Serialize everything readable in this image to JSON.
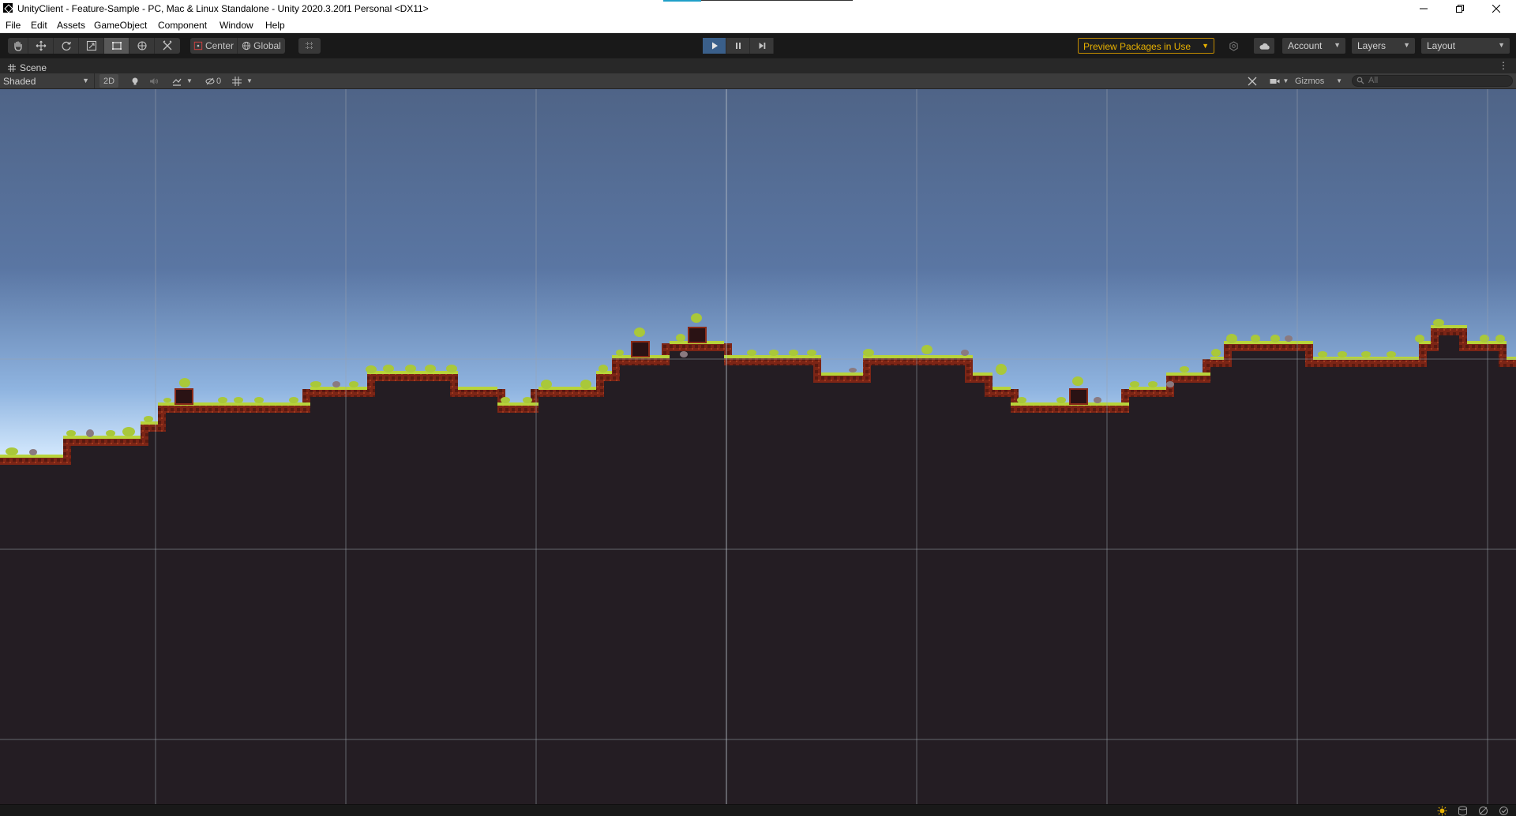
{
  "window": {
    "title": "UnityClient - Feature-Sample - PC, Mac & Linux Standalone - Unity 2020.3.20f1 Personal <DX11>",
    "controls": [
      "minimize",
      "maximize",
      "close"
    ]
  },
  "menu": {
    "items": [
      "File",
      "Edit",
      "Assets",
      "GameObject",
      "Component",
      "Window",
      "Help"
    ]
  },
  "toolbar": {
    "tools": [
      "hand-tool",
      "move-tool",
      "rotate-tool",
      "scale-tool",
      "rect-tool",
      "transform-tool",
      "custom-tool"
    ],
    "active_tool": "rect-tool",
    "pivot_mode": "Center",
    "pivot_rotation": "Global",
    "play_controls": [
      "play",
      "pause",
      "step"
    ],
    "preview_packages": "Preview Packages in Use",
    "account": "Account",
    "layers": "Layers",
    "layout": "Layout"
  },
  "scene": {
    "tab_label": "Scene",
    "draw_mode": "Shaded",
    "mode_2d": "2D",
    "hidden_count": "0",
    "gizmos": "Gizmos",
    "search_placeholder": "All"
  },
  "colors": {
    "sky_top": "#4f6487",
    "sky_bottom": "#d8ecff",
    "ground": "#241d23",
    "grass": "#b8d43a",
    "dirt_edge": "#8a2a18",
    "grid_line": "#9aa3ad",
    "preview_accent": "#e8b100"
  },
  "status": {
    "icons": [
      "lighting-icon",
      "cache-icon",
      "network-icon",
      "check-icon"
    ]
  }
}
